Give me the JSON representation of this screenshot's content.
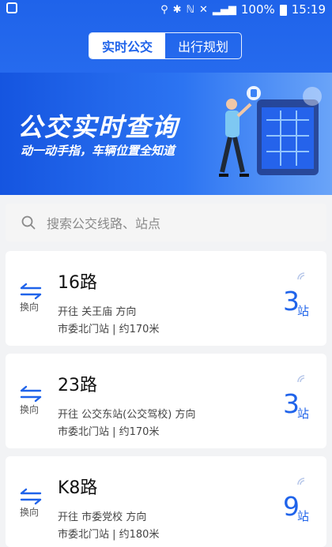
{
  "status_bar": {
    "battery": "100%",
    "time": "15:19"
  },
  "tabs": [
    {
      "label": "实时公交",
      "active": true
    },
    {
      "label": "出行规划",
      "active": false
    }
  ],
  "banner": {
    "title": "公交实时查询",
    "subtitle": "动一动手指，车辆位置全知道"
  },
  "search": {
    "placeholder": "搜索公交线路、站点"
  },
  "routes": [
    {
      "name": "16路",
      "toward_prefix": "开往",
      "toward": "关王庙",
      "toward_suffix": "方向",
      "stop_info": "市委北门站 | 约170米",
      "stops_away": "3",
      "unit": "站",
      "swap_label": "换向"
    },
    {
      "name": "23路",
      "toward_prefix": "开往",
      "toward": "公交东站(公交驾校)",
      "toward_suffix": "方向",
      "stop_info": "市委北门站 | 约170米",
      "stops_away": "3",
      "unit": "站",
      "swap_label": "换向"
    },
    {
      "name": "K8路",
      "toward_prefix": "开往",
      "toward": "市委党校",
      "toward_suffix": "方向",
      "stop_info": "市委北门站 | 约180米",
      "stops_away": "9",
      "unit": "站",
      "swap_label": "换向"
    }
  ],
  "icons": {
    "swap": "swap-direction-icon",
    "search": "search-icon",
    "realtime": "realtime-signal-icon"
  },
  "colors": {
    "primary": "#1f63ea"
  }
}
